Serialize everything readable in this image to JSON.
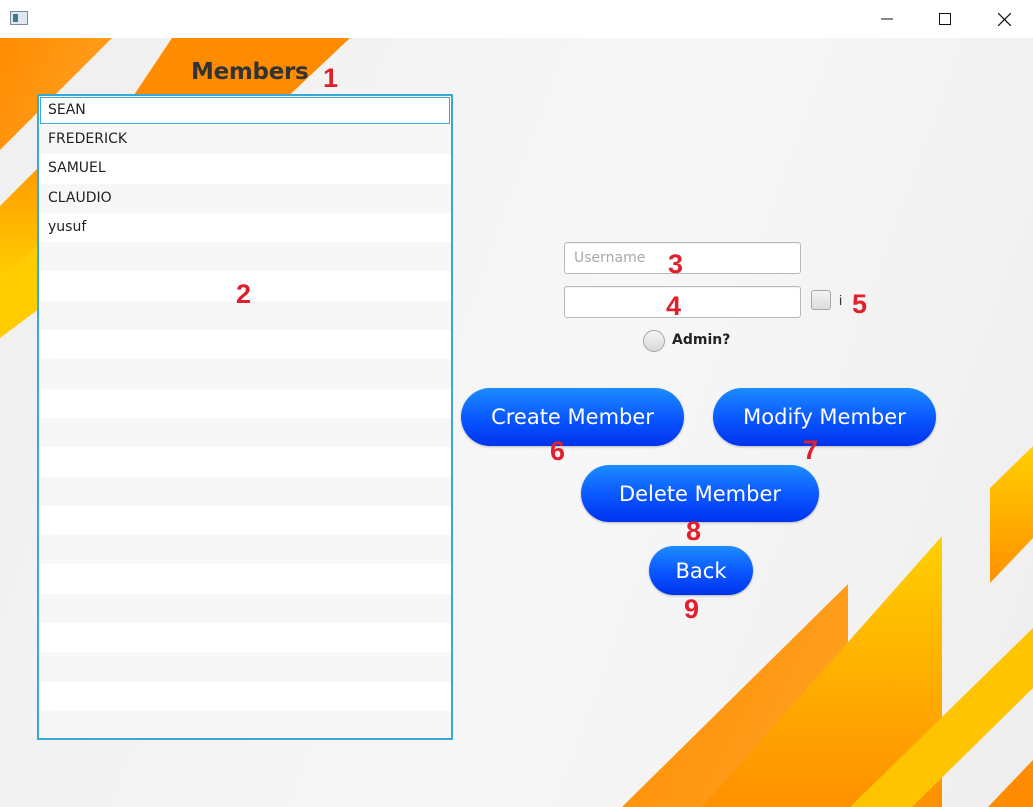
{
  "window": {
    "icons": {
      "app": "app-window-icon",
      "minimize": "minimize-icon",
      "maximize": "maximize-icon",
      "close": "close-icon"
    }
  },
  "page": {
    "title": "Members"
  },
  "members": {
    "items": [
      "SEAN",
      "FREDERICK",
      "SAMUEL",
      "CLAUDIO",
      "yusuf"
    ],
    "selected_index": 0,
    "empty_rows": 17
  },
  "form": {
    "username": {
      "value": "",
      "placeholder": "Username"
    },
    "password": {
      "value": "",
      "placeholder": ""
    },
    "show_checkbox_label": "i",
    "show_checkbox_checked": false,
    "admin_label": "Admin?",
    "admin_selected": false
  },
  "buttons": {
    "create": "Create Member",
    "modify": "Modify Member",
    "delete": "Delete Member",
    "back": "Back"
  },
  "annotations": [
    "1",
    "2",
    "3",
    "4",
    "5",
    "6",
    "7",
    "8",
    "9"
  ],
  "colors": {
    "accent_blue": "#0a55ff",
    "list_border": "#3aa8d6",
    "annotation_red": "#e0202c",
    "stripe_orange": "#ff8c00",
    "stripe_yellow": "#ffd000"
  }
}
